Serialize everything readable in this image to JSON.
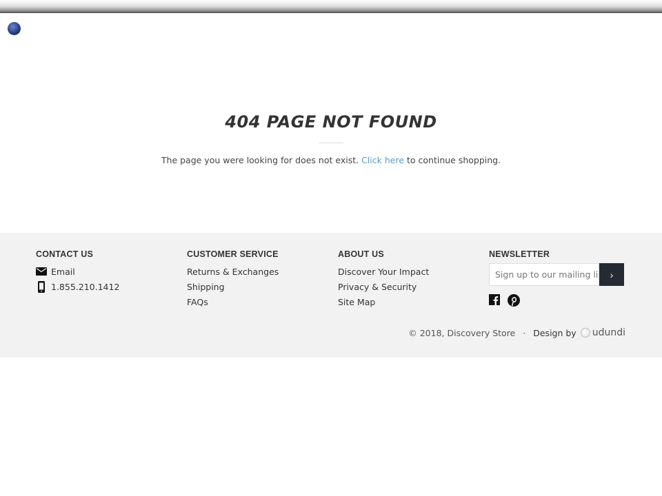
{
  "page": {
    "title": "404 PAGE NOT FOUND",
    "message_before": "The page you were looking for does not exist. ",
    "link_text": "Click here",
    "message_after": " to continue shopping."
  },
  "footer": {
    "contact": {
      "heading": "CONTACT US",
      "email": "Email",
      "phone": "1.855.210.1412"
    },
    "customer_service": {
      "heading": "CUSTOMER SERVICE",
      "links": [
        "Returns & Exchanges",
        "Shipping",
        "FAQs"
      ]
    },
    "about": {
      "heading": "ABOUT US",
      "links": [
        "Discover Your Impact",
        "Privacy & Security",
        "Site Map"
      ]
    },
    "newsletter": {
      "heading": "NEWSLETTER",
      "placeholder": "Sign up to our mailing list",
      "submit": "›"
    },
    "social": [
      "facebook-icon",
      "pinterest-icon"
    ],
    "copyright": "© 2018, Discovery Store",
    "separator": "·",
    "design_by": "Design by",
    "designer": "udundi"
  },
  "colors": {
    "link": "#5a9ec9",
    "footer_bg": "#f2f2f2",
    "button": "#262a33"
  }
}
